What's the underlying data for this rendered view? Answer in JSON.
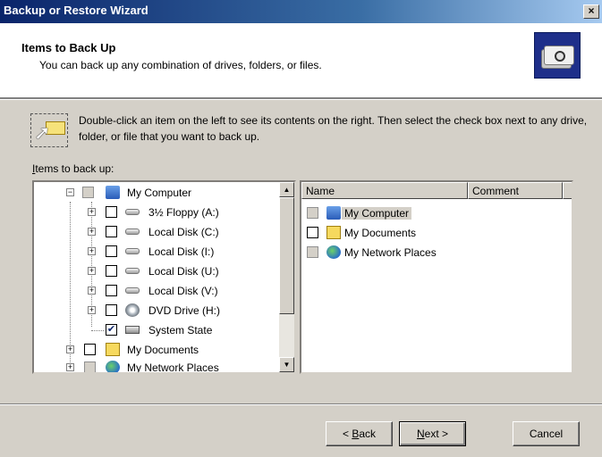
{
  "window": {
    "title": "Backup or Restore Wizard",
    "close_label": "×"
  },
  "header": {
    "title": "Items to Back Up",
    "subtitle": "You can back up any combination of drives, folders, or files."
  },
  "instruction": "Double-click an item on the left to see its contents on the right. Then select the check box next to any drive, folder, or file that you want to back up.",
  "items_label": {
    "accel": "I",
    "rest": "tems to back up:"
  },
  "tree": [
    {
      "label": "My Computer",
      "check": "partial",
      "icon": "computer-icon"
    },
    {
      "label": "3½ Floppy (A:)",
      "check": "unchecked",
      "icon": "floppy-drive-icon"
    },
    {
      "label": "Local Disk (C:)",
      "check": "unchecked",
      "icon": "hard-drive-icon"
    },
    {
      "label": "Local Disk (I:)",
      "check": "unchecked",
      "icon": "hard-drive-icon"
    },
    {
      "label": "Local Disk (U:)",
      "check": "unchecked",
      "icon": "hard-drive-icon"
    },
    {
      "label": "Local Disk (V:)",
      "check": "unchecked",
      "icon": "hard-drive-icon"
    },
    {
      "label": "DVD Drive (H:)",
      "check": "unchecked",
      "icon": "dvd-drive-icon"
    },
    {
      "label": "System State",
      "check": "checked",
      "icon": "system-state-icon"
    },
    {
      "label": "My Documents",
      "check": "unchecked",
      "icon": "my-documents-icon"
    },
    {
      "label": "My Network Places",
      "check": "partial",
      "icon": "network-places-icon"
    }
  ],
  "list": {
    "columns": [
      "Name",
      "Comment"
    ],
    "rows": [
      {
        "name": "My Computer",
        "check": "partial",
        "icon": "computer-icon"
      },
      {
        "name": "My Documents",
        "check": "unchecked",
        "icon": "my-documents-icon"
      },
      {
        "name": "My Network Places",
        "check": "partial",
        "icon": "network-places-icon"
      }
    ]
  },
  "buttons": {
    "back": {
      "accel": "B",
      "rest": "ack",
      "prefix": "< "
    },
    "next": {
      "accel": "N",
      "rest": "ext",
      "suffix": " >"
    },
    "cancel": "Cancel"
  }
}
